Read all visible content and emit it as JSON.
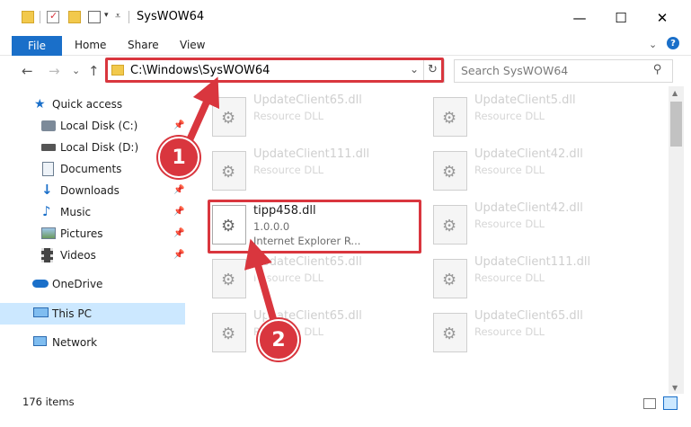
{
  "window": {
    "title": "SysWOW64",
    "minimize": "—",
    "maximize": "☐",
    "close": "✕"
  },
  "ribbon": {
    "file": "File",
    "home": "Home",
    "share": "Share",
    "view": "View"
  },
  "nav": {
    "back": "←",
    "forward": "→",
    "recent": "⌄",
    "up": "↑",
    "address": "C:\\Windows\\SysWOW64",
    "search_placeholder": "Search SysWOW64"
  },
  "sidebar": {
    "items": [
      {
        "label": "Quick access",
        "pinned": false
      },
      {
        "label": "Local Disk (C:)",
        "pinned": true
      },
      {
        "label": "Local Disk (D:)",
        "pinned": false
      },
      {
        "label": "Documents",
        "pinned": true
      },
      {
        "label": "Downloads",
        "pinned": true
      },
      {
        "label": "Music",
        "pinned": true
      },
      {
        "label": "Pictures",
        "pinned": true
      },
      {
        "label": "Videos",
        "pinned": true
      },
      {
        "label": "OneDrive",
        "pinned": false
      },
      {
        "label": "This PC",
        "pinned": false,
        "selected": true
      },
      {
        "label": "Network",
        "pinned": false
      }
    ]
  },
  "files": {
    "left": [
      {
        "name": "UpdateClient65.dll",
        "desc": "Resource DLL"
      },
      {
        "name": "UpdateClient111.dll",
        "desc": "Resource DLL"
      },
      {
        "name": "tipp458.dll",
        "version": "1.0.0.0",
        "desc": "Internet Explorer R...",
        "selected": true
      },
      {
        "name": "UpdateClient65.dll",
        "desc": "Resource DLL"
      },
      {
        "name": "UpdateClient65.dll",
        "desc": "Resource DLL"
      }
    ],
    "right": [
      {
        "name": "UpdateClient5.dll",
        "desc": "Resource DLL"
      },
      {
        "name": "UpdateClient42.dll",
        "desc": "Resource DLL"
      },
      {
        "name": "UpdateClient42.dll",
        "desc": "Resource DLL"
      },
      {
        "name": "UpdateClient111.dll",
        "desc": "Resource DLL"
      },
      {
        "name": "UpdateClient65.dll",
        "desc": "Resource DLL"
      }
    ]
  },
  "status": {
    "count": "176 items"
  },
  "annotations": {
    "step1": "1",
    "step2": "2",
    "color": "#d9363e"
  },
  "colors": {
    "accent": "#1a6fc9",
    "selected_nav": "#cce8ff"
  }
}
